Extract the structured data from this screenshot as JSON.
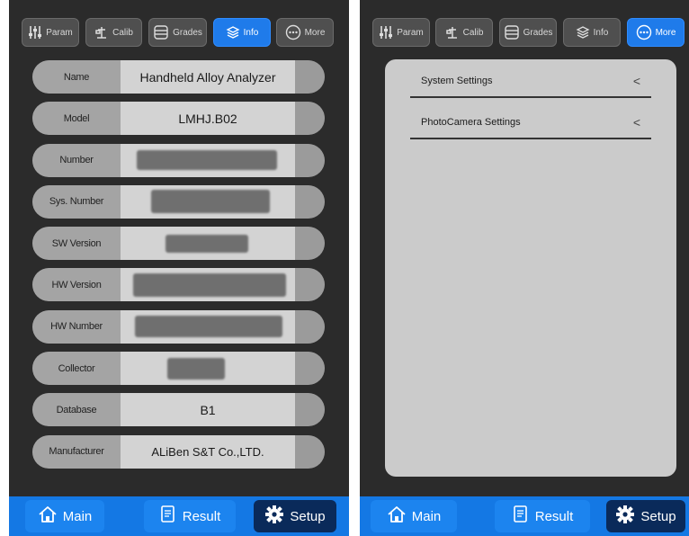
{
  "tabs": [
    {
      "label": "Param",
      "icon": "sliders-icon"
    },
    {
      "label": "Calib",
      "icon": "calibration-icon"
    },
    {
      "label": "Grades",
      "icon": "database-icon"
    },
    {
      "label": "Info",
      "icon": "layers-icon"
    },
    {
      "label": "More",
      "icon": "more-dots-icon"
    }
  ],
  "left": {
    "active_tab": "Info",
    "rows": [
      {
        "label": "Name",
        "value": "Handheld Alloy Analyzer"
      },
      {
        "label": "Model",
        "value": "LMHJ.B02"
      },
      {
        "label": "Number",
        "value": ""
      },
      {
        "label": "Sys. Number",
        "value": ""
      },
      {
        "label": "SW Version",
        "value": ""
      },
      {
        "label": "HW Version",
        "value": ""
      },
      {
        "label": "HW Number",
        "value": ""
      },
      {
        "label": "Collector",
        "value": ""
      },
      {
        "label": "Database",
        "value": "B1"
      },
      {
        "label": "Manufacturer",
        "value": "ALiBen S&T Co.,LTD."
      }
    ]
  },
  "right": {
    "active_tab": "More",
    "settings": [
      {
        "label": "System Settings",
        "chevron": "<"
      },
      {
        "label": "PhotoCamera Settings",
        "chevron": "<"
      }
    ]
  },
  "bottom": [
    {
      "label": "Main",
      "icon": "home-icon"
    },
    {
      "label": "Result",
      "icon": "result-icon"
    },
    {
      "label": "Setup",
      "icon": "gear-icon"
    }
  ],
  "colors": {
    "accent": "#1f7bea",
    "bottom_bar": "#1478e4",
    "active_bottom": "#0a2a5a",
    "background": "#2b2b2b"
  }
}
